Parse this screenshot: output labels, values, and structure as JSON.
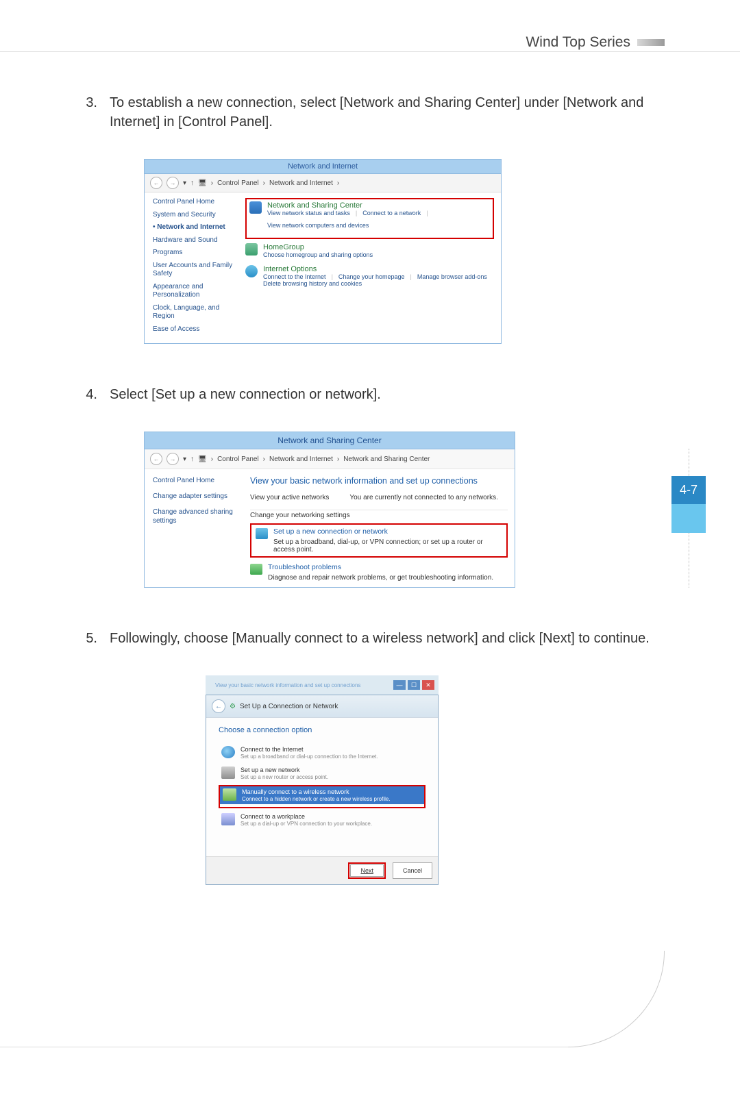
{
  "header": {
    "series_title": "Wind Top Series"
  },
  "page_tab": {
    "number": "4-7"
  },
  "steps": {
    "s3": {
      "num": "3.",
      "text": "To establish a new connection, select [Network and Sharing Center] under [Network and Internet] in [Control Panel]."
    },
    "s4": {
      "num": "4.",
      "text": "Select [Set up a new connection or network]."
    },
    "s5": {
      "num": "5.",
      "text": "Followingly, choose [Manually connect to a wireless network] and click [Next] to continue."
    }
  },
  "ss1": {
    "title": "Network and Internet",
    "breadcrumb": {
      "root": "Control Panel",
      "current": "Network and Internet"
    },
    "sidebar": {
      "home": "Control Panel Home",
      "items": [
        "System and Security",
        "Network and Internet",
        "Hardware and Sound",
        "Programs",
        "User Accounts and Family Safety",
        "Appearance and Personalization",
        "Clock, Language, and Region",
        "Ease of Access"
      ]
    },
    "main": {
      "nsc": {
        "title": "Network and Sharing Center",
        "links": [
          "View network status and tasks",
          "Connect to a network",
          "View network computers and devices"
        ]
      },
      "homegroup": {
        "title": "HomeGroup",
        "desc": "Choose homegroup and sharing options"
      },
      "inet": {
        "title": "Internet Options",
        "links": [
          "Connect to the Internet",
          "Change your homepage",
          "Manage browser add-ons"
        ],
        "desc": "Delete browsing history and cookies"
      }
    }
  },
  "ss2": {
    "title": "Network and Sharing Center",
    "breadcrumb": {
      "root": "Control Panel",
      "mid": "Network and Internet",
      "current": "Network and Sharing Center"
    },
    "sidebar": {
      "home": "Control Panel Home",
      "links": [
        "Change adapter settings",
        "Change advanced sharing settings"
      ]
    },
    "main": {
      "heading": "View your basic network information and set up connections",
      "row1_label": "View your active networks",
      "row1_status": "You are currently not connected to any networks.",
      "change_label": "Change your networking settings",
      "setup": {
        "title": "Set up a new connection or network",
        "desc": "Set up a broadband, dial-up, or VPN connection; or set up a router or access point."
      },
      "trouble": {
        "title": "Troubleshoot problems",
        "desc": "Diagnose and repair network problems, or get troubleshooting information."
      }
    }
  },
  "ss3": {
    "window_hint": "View your basic network information and set up connections",
    "title": "Set Up a Connection or Network",
    "heading": "Choose a connection option",
    "options": [
      {
        "title": "Connect to the Internet",
        "desc": "Set up a broadband or dial-up connection to the Internet."
      },
      {
        "title": "Set up a new network",
        "desc": "Set up a new router or access point."
      },
      {
        "title": "Manually connect to a wireless network",
        "desc": "Connect to a hidden network or create a new wireless profile."
      },
      {
        "title": "Connect to a workplace",
        "desc": "Set up a dial-up or VPN connection to your workplace."
      }
    ],
    "buttons": {
      "next": "Next",
      "cancel": "Cancel"
    }
  }
}
